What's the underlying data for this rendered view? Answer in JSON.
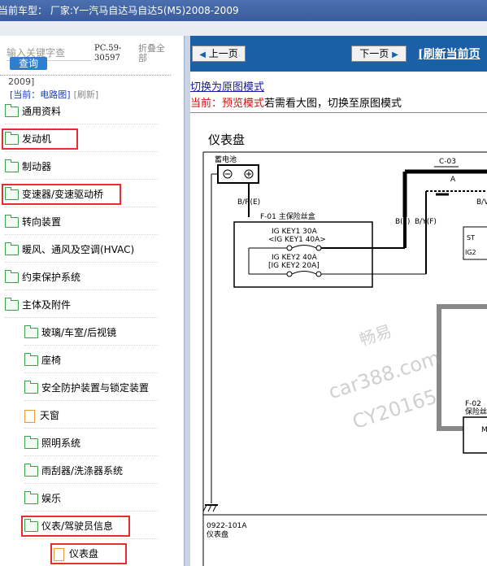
{
  "window": {
    "title": "当前车型：  厂家:Y一汽马自达马自达5(M5)2008-2009"
  },
  "left": {
    "search_placeholder": "输入关键字查",
    "search_button": "查询",
    "code": "PC.59-30597",
    "collapse_all": "折叠全部",
    "old_year": "2009]",
    "current_label": "[当前：电路图]",
    "refresh": "[刷新]",
    "tree": [
      {
        "label": "通用资料",
        "level": 0,
        "type": "folder"
      },
      {
        "label": "发动机",
        "level": 0,
        "type": "folder",
        "highlight": true
      },
      {
        "label": "制动器",
        "level": 0,
        "type": "folder"
      },
      {
        "label": "变速器/变速驱动桥",
        "level": 0,
        "type": "folder",
        "highlight": true
      },
      {
        "label": "转向装置",
        "level": 0,
        "type": "folder"
      },
      {
        "label": "暖风、通风及空调(HVAC)",
        "level": 0,
        "type": "folder"
      },
      {
        "label": "约束保护系统",
        "level": 0,
        "type": "folder"
      },
      {
        "label": "主体及附件",
        "level": 0,
        "type": "folder-open"
      },
      {
        "label": "玻璃/车室/后视镜",
        "level": 1,
        "type": "folder"
      },
      {
        "label": "座椅",
        "level": 1,
        "type": "folder"
      },
      {
        "label": "安全防护装置与锁定装置",
        "level": 1,
        "type": "folder"
      },
      {
        "label": "天窗",
        "level": 1,
        "type": "doc"
      },
      {
        "label": "照明系统",
        "level": 1,
        "type": "folder"
      },
      {
        "label": "雨刮器/洗涤器系统",
        "level": 1,
        "type": "folder"
      },
      {
        "label": "娱乐",
        "level": 1,
        "type": "folder"
      },
      {
        "label": "仪表/驾驶员信息",
        "level": 1,
        "type": "folder-open",
        "highlight": true
      },
      {
        "label": "仪表盘",
        "level": 2,
        "type": "doc",
        "highlight": true
      }
    ]
  },
  "right": {
    "prev_button": "上一页",
    "next_button": "下一页",
    "refresh_page": "[刷新当前页",
    "switch_link": "切换为原图模式",
    "current_prefix": "当前：",
    "current_mode": "预览模式",
    "current_suffix": "若需看大图，切换至原图模式"
  },
  "diagram": {
    "title": "仪表盘",
    "battery": "蓄电池",
    "wire_br_e": "B/R(E)",
    "fuse_box": "F-01  主保险丝盒",
    "fuse1_a": "IG KEY1 30A",
    "fuse1_b": "<IG KEY1 40A>",
    "fuse2_a": "IG KEY2 40A",
    "fuse2_b": "[IG KEY2 20A]",
    "wire_b_f": "B(F)",
    "wire_by_f": "B/Y(F)",
    "connector_c03": "C-03",
    "connector_a": "A",
    "wire_bv": "B/V",
    "st": "ST",
    "ig2": "IG2",
    "f02": "F-02",
    "f02_sub": "保险丝",
    "m_label": "M",
    "code": "0922-101A",
    "footer": "仪表盘",
    "watermark1": "畅易",
    "watermark2": "car388.com",
    "watermark3": "CY20165"
  },
  "colors": {
    "titlebar": "#3b5c9c",
    "navbar": "#1b5fa6",
    "highlight": "#e23030",
    "folder": "#3aa14a"
  }
}
